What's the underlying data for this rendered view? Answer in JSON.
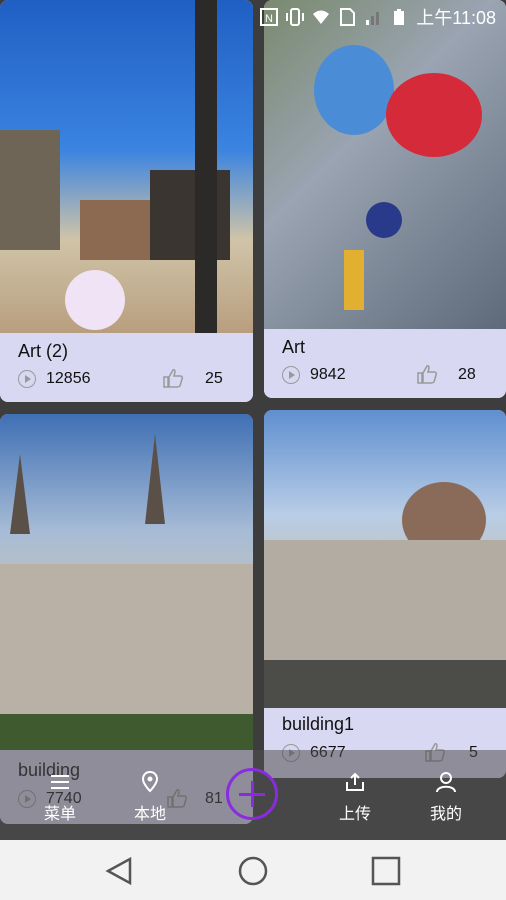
{
  "status_bar": {
    "time": "上午11:08"
  },
  "cards": [
    {
      "title": "Art (2)",
      "views": "12856",
      "likes": "25"
    },
    {
      "title": "Art",
      "views": "9842",
      "likes": "28"
    },
    {
      "title": "building",
      "views": "7740",
      "likes": "81"
    },
    {
      "title": "building1",
      "views": "6677",
      "likes": "5"
    }
  ],
  "bottom_nav": {
    "items": [
      {
        "label": "菜单",
        "icon": "menu-icon"
      },
      {
        "label": "本地",
        "icon": "location-icon"
      },
      {
        "label": "上传",
        "icon": "upload-icon"
      },
      {
        "label": "我的",
        "icon": "user-icon"
      }
    ],
    "add_icon": "add-icon",
    "accent": "#8a2be2"
  },
  "system_nav": {
    "icons": [
      "back-icon",
      "home-icon",
      "recent-apps-icon"
    ]
  }
}
